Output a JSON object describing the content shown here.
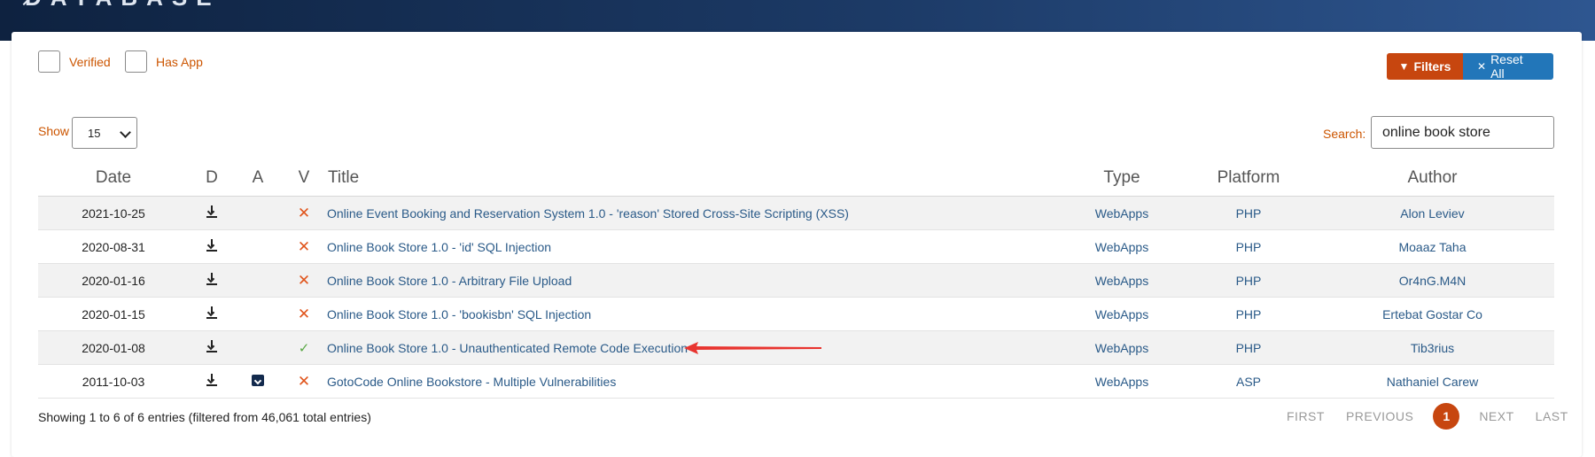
{
  "brand": {
    "name": "DATABASE"
  },
  "filters": {
    "verified_label": "Verified",
    "has_app_label": "Has App",
    "filters_button": "Filters",
    "reset_button": "Reset All"
  },
  "length_control": {
    "label": "Show",
    "value": "15"
  },
  "search": {
    "label": "Search:",
    "value": "online book store"
  },
  "table": {
    "headers": {
      "date": "Date",
      "d": "D",
      "a": "A",
      "v": "V",
      "title": "Title",
      "type": "Type",
      "platform": "Platform",
      "author": "Author"
    },
    "rows": [
      {
        "date": "2021-10-25",
        "has_app": false,
        "verified": false,
        "title": "Online Event Booking and Reservation System 1.0 - 'reason' Stored Cross-Site Scripting (XSS)",
        "type": "WebApps",
        "platform": "PHP",
        "author": "Alon Leviev"
      },
      {
        "date": "2020-08-31",
        "has_app": false,
        "verified": false,
        "title": "Online Book Store 1.0 - 'id' SQL Injection",
        "type": "WebApps",
        "platform": "PHP",
        "author": "Moaaz Taha"
      },
      {
        "date": "2020-01-16",
        "has_app": false,
        "verified": false,
        "title": "Online Book Store 1.0 - Arbitrary File Upload",
        "type": "WebApps",
        "platform": "PHP",
        "author": "Or4nG.M4N"
      },
      {
        "date": "2020-01-15",
        "has_app": false,
        "verified": false,
        "title": "Online Book Store 1.0 - 'bookisbn' SQL Injection",
        "type": "WebApps",
        "platform": "PHP",
        "author": "Ertebat Gostar Co"
      },
      {
        "date": "2020-01-08",
        "has_app": false,
        "verified": true,
        "title": "Online Book Store 1.0 - Unauthenticated Remote Code Execution",
        "type": "WebApps",
        "platform": "PHP",
        "author": "Tib3rius"
      },
      {
        "date": "2011-10-03",
        "has_app": true,
        "verified": false,
        "title": "GotoCode Online Bookstore - Multiple Vulnerabilities",
        "type": "WebApps",
        "platform": "ASP",
        "author": "Nathaniel Carew"
      }
    ]
  },
  "info": "Showing 1 to 6 of 6 entries (filtered from 46,061 total entries)",
  "pagination": {
    "first": "FIRST",
    "previous": "PREVIOUS",
    "current": "1",
    "next": "NEXT",
    "last": "LAST"
  },
  "colors": {
    "accent_orange": "#c7460f",
    "accent_blue": "#2276b9",
    "link": "#2a5a88",
    "header_dark": "#0e2240"
  },
  "icons": {
    "download": "download-icon",
    "app": "app-archive-icon",
    "not_verified": "x-mark-icon",
    "verified": "check-mark-icon",
    "annotation": "red-arrow"
  }
}
